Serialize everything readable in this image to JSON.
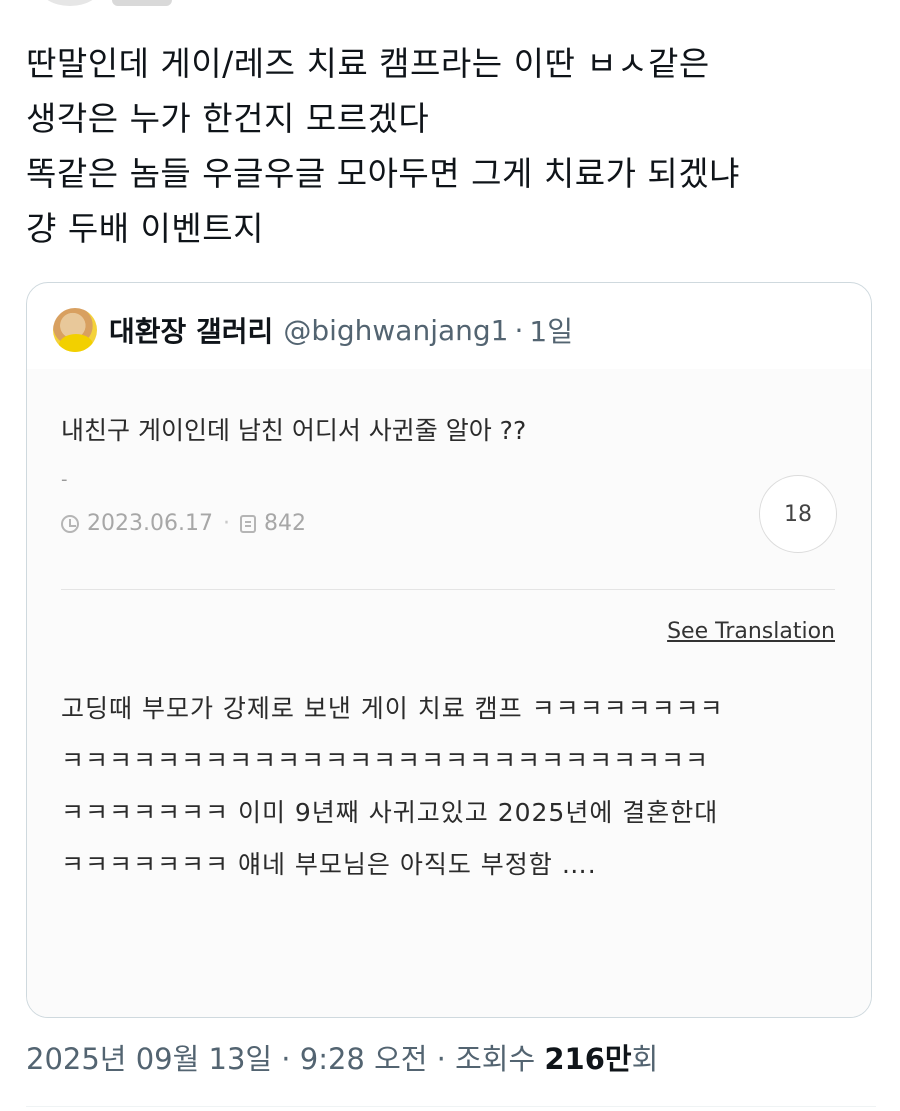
{
  "tweet": {
    "text_lines": [
      "딴말인데 게이/레즈 치료 캠프라는 이딴 ㅂㅅ같은",
      "생각은 누가 한건지 모르겠다",
      "똑같은 놈들 우글우글 모아두면 그게 치료가 되겠냐",
      "걍 두배 이벤트지"
    ]
  },
  "quoted_tweet": {
    "author_name": "대환장 갤러리",
    "handle": "@bighwanjang1",
    "separator": "·",
    "time": "1일",
    "post": {
      "title": "내친구 게이인데 남친 어디서 사귄줄 알아 ??",
      "dash": "-",
      "date": "2023.06.17",
      "meta_separator": "·",
      "views": "842",
      "comment_count": "18",
      "see_translation": "See Translation",
      "body_lines": [
        "고딩때 부모가 강제로 보낸 게이 치료 캠프 ㅋㅋㅋㅋㅋㅋㅋㅋ",
        "ㅋㅋㅋㅋㅋㅋㅋㅋㅋㅋㅋㅋㅋㅋㅋㅋㅋㅋㅋㅋㅋㅋㅋㅋㅋㅋㅋ",
        "ㅋㅋㅋㅋㅋㅋㅋ 이미 9년째 사귀고있고 2025년에 결혼한대",
        "ㅋㅋㅋㅋㅋㅋㅋ 얘네 부모님은 아직도 부정함 …."
      ]
    }
  },
  "footer": {
    "timestamp": "2025년 09월 13일 · 9:28 오전 · 조회수 ",
    "views_count": "216만",
    "views_suffix": "회"
  }
}
